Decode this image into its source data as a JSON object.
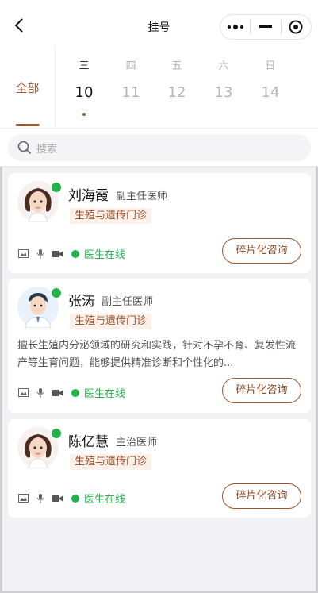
{
  "nav": {
    "title": "挂号"
  },
  "tabs": {
    "all_label": "全部"
  },
  "days": [
    {
      "weekday": "三",
      "date": "10",
      "selected": true
    },
    {
      "weekday": "四",
      "date": "11"
    },
    {
      "weekday": "五",
      "date": "12"
    },
    {
      "weekday": "六",
      "date": "13"
    },
    {
      "weekday": "日",
      "date": "14"
    }
  ],
  "search": {
    "placeholder": "搜索"
  },
  "doctors": [
    {
      "name": "刘海霞",
      "rank": "副主任医师",
      "dept": "生殖与遗传门诊",
      "desc": "",
      "status": "医生在线",
      "action": "碎片化咨询",
      "avatar": "female-doctor-avatar"
    },
    {
      "name": "张涛",
      "rank": "副主任医师",
      "dept": "生殖与遗传门诊",
      "desc": "擅长生殖内分泌领域的研究和实践，针对不孕不育、复发性流产等生育问题，能够提供精准诊断和个性化的...",
      "status": "医生在线",
      "action": "碎片化咨询",
      "avatar": "male-doctor-avatar"
    },
    {
      "name": "陈亿慧",
      "rank": "主治医师",
      "dept": "生殖与遗传门诊",
      "desc": "",
      "status": "医生在线",
      "action": "碎片化咨询",
      "avatar": "female-doctor-avatar"
    }
  ],
  "colors": {
    "accent": "#9a5a36",
    "online": "#22b24c",
    "tag_bg": "#fbf1ea"
  }
}
